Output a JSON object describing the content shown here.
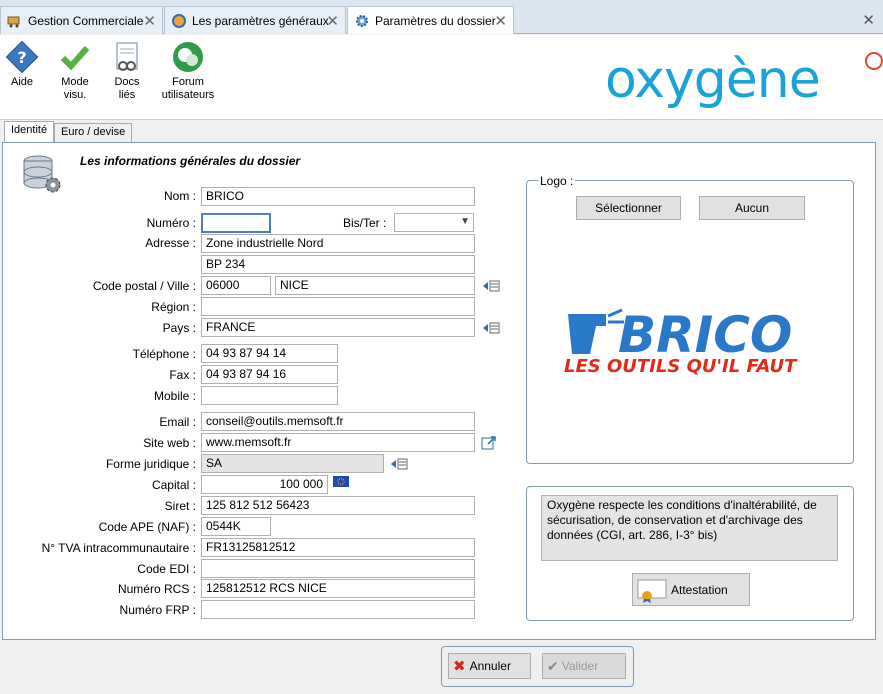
{
  "tabs": [
    {
      "label": "Gestion Commerciale",
      "icon": "cart-icon"
    },
    {
      "label": "Les paramètres généraux",
      "icon": "settings-globe-icon"
    },
    {
      "label": "Paramètres du dossier",
      "icon": "gear-icon",
      "active": true
    }
  ],
  "toolbar": {
    "help": "Aide",
    "mode_visu_line1": "Mode",
    "mode_visu_line2": "visu.",
    "docs_line1": "Docs",
    "docs_line2": "liés",
    "forum_line1": "Forum",
    "forum_line2": "utilisateurs"
  },
  "brand": {
    "logo_text": "oxygène",
    "color": "#1aa3d9"
  },
  "inner_tabs": [
    "Identité",
    "Euro / devise"
  ],
  "section_title": "Les informations générales du dossier",
  "labels": {
    "nom": "Nom :",
    "numero": "Numéro :",
    "bister": "Bis/Ter :",
    "adresse": "Adresse :",
    "cp_ville": "Code postal / Ville :",
    "region": "Région :",
    "pays": "Pays :",
    "telephone": "Téléphone :",
    "fax": "Fax :",
    "mobile": "Mobile :",
    "email": "Email :",
    "site": "Site web :",
    "forme": "Forme juridique :",
    "capital": "Capital :",
    "siret": "Siret :",
    "ape": "Code APE (NAF) :",
    "tva": "N° TVA intracommunautaire :",
    "edi": "Code EDI :",
    "rcs": "Numéro RCS :",
    "frp": "Numéro FRP :"
  },
  "values": {
    "nom": "BRICO",
    "numero": "",
    "bister": "",
    "adresse1": "Zone industrielle Nord",
    "adresse2": "BP 234",
    "cp": "06000",
    "ville": "NICE",
    "region": "",
    "pays": "FRANCE",
    "telephone": "04 93 87 94 14",
    "fax": "04 93 87 94 16",
    "mobile": "",
    "email": "conseil@outils.memsoft.fr",
    "site": "www.memsoft.fr",
    "forme": "SA",
    "capital": "100 000",
    "siret": "125 812 512 56423",
    "ape": "0544K",
    "tva": "FR13125812512",
    "edi": "",
    "rcs": "125812512 RCS NICE",
    "frp": ""
  },
  "logo_box": {
    "title": "Logo :",
    "select_button": "Sélectionner",
    "none_button": "Aucun",
    "brand_name": "BRICO",
    "brand_slogan": "LES OUTILS QU'IL FAUT"
  },
  "notice": {
    "text": "Oxygène respecte les conditions d'inaltérabilité, de sécurisation, de conservation et d'archivage des données (CGI, art. 286, I-3° bis)",
    "attestation_button": "Attestation"
  },
  "footer": {
    "cancel": "Annuler",
    "validate": "Valider"
  }
}
